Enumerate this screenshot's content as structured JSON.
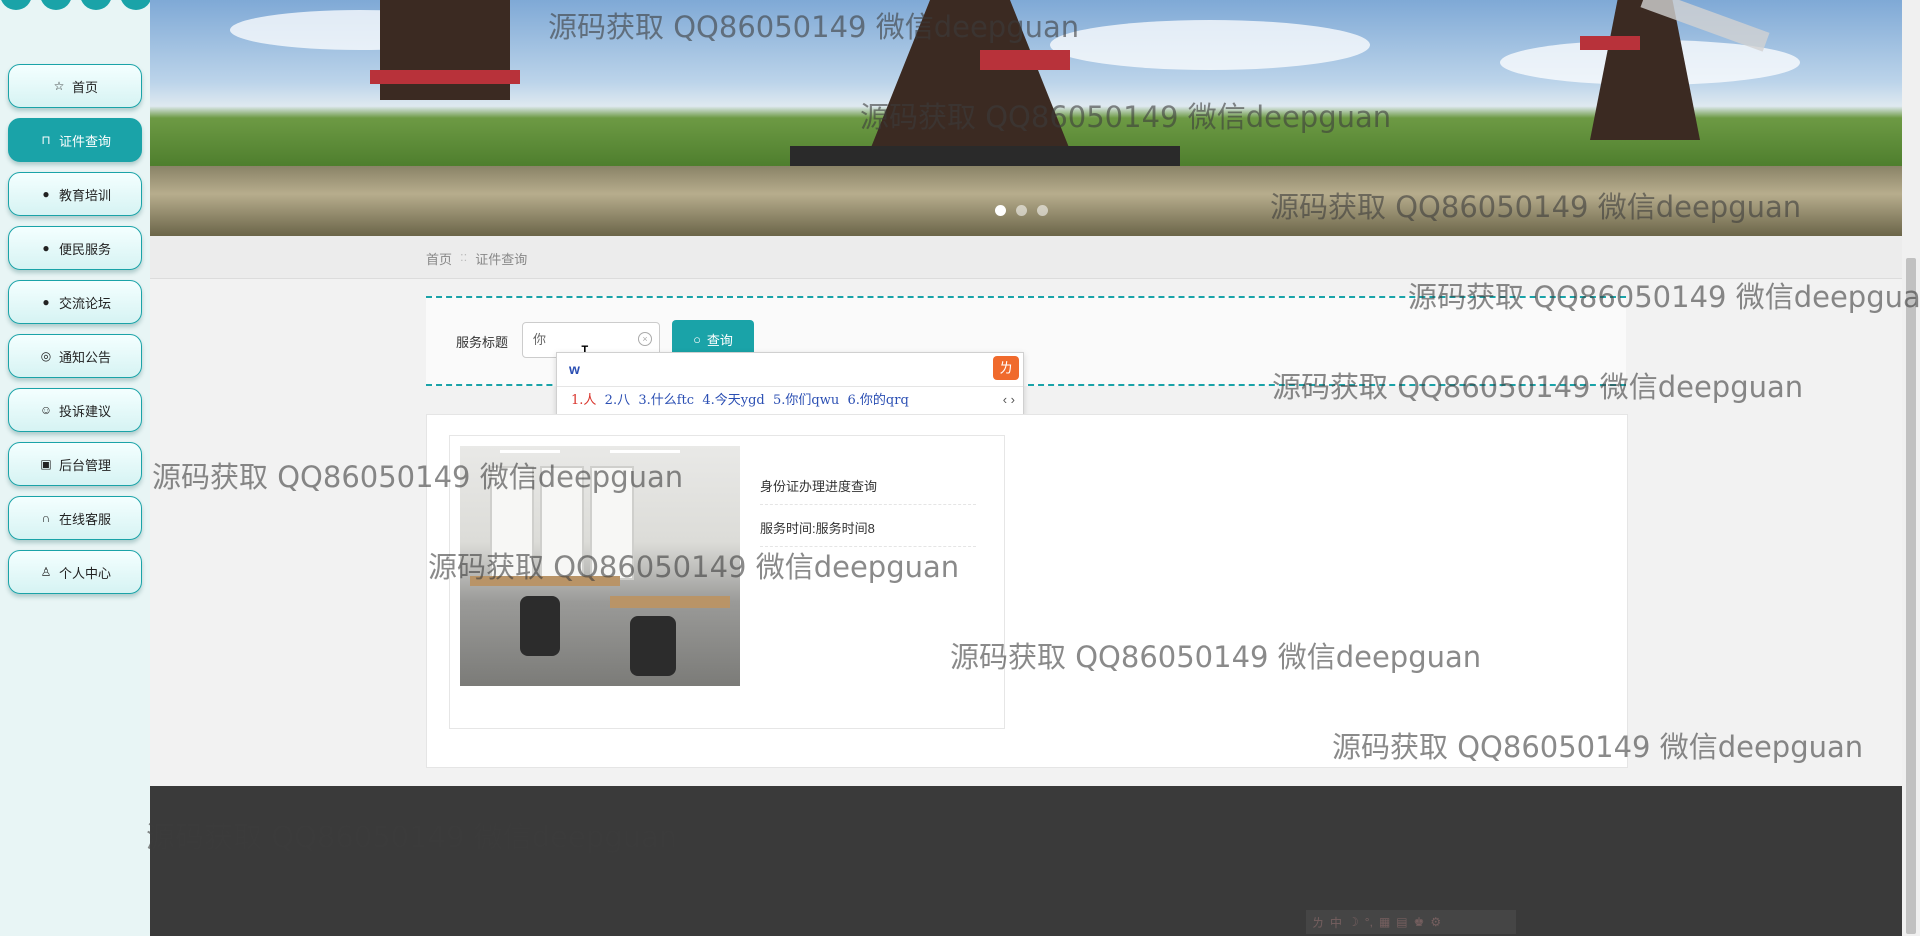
{
  "sidebar": {
    "items": [
      {
        "label": "首页",
        "icon": "star-icon"
      },
      {
        "label": "证件查询",
        "icon": "lock-icon",
        "active": true
      },
      {
        "label": "教育培训",
        "icon": "info-icon"
      },
      {
        "label": "便民服务",
        "icon": "help-icon"
      },
      {
        "label": "交流论坛",
        "icon": "info-icon"
      },
      {
        "label": "通知公告",
        "icon": "settings-icon"
      },
      {
        "label": "投诉建议",
        "icon": "smile-icon"
      },
      {
        "label": "后台管理",
        "icon": "briefcase-icon"
      },
      {
        "label": "在线客服",
        "icon": "headset-icon"
      },
      {
        "label": "个人中心",
        "icon": "user-icon"
      }
    ]
  },
  "breadcrumb": {
    "home": "首页",
    "separator": "::",
    "current": "证件查询"
  },
  "search": {
    "label": "服务标题",
    "value": "你",
    "button_label": "查询"
  },
  "ime": {
    "input": "w",
    "candidates": [
      "1.人",
      "2.八",
      "3.什么ftc",
      "4.今天ygd",
      "5.你们qwu",
      "6.你的qrq"
    ]
  },
  "results": [
    {
      "title": "身份证办理进度查询",
      "time_text": "服务时间:服务时间8"
    }
  ],
  "watermark": "源码获取 QQ86050149 微信deepguan",
  "colors": {
    "accent": "#1aa3a8",
    "footer": "#3a3a3a",
    "ime_candidate": "#2b4fb3",
    "ime_first": "#d9342b"
  }
}
